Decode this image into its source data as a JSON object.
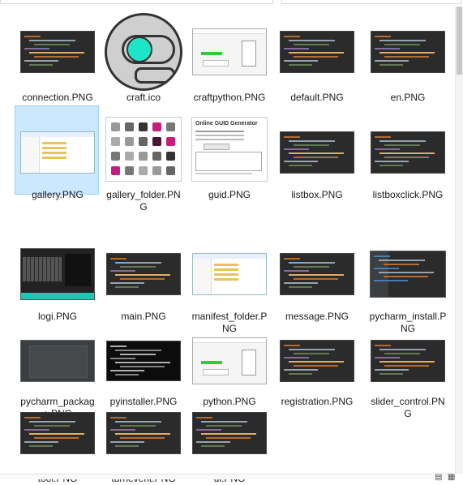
{
  "window": {
    "accent": "#0078d7",
    "selected_bg": "#cce8ff"
  },
  "files": [
    {
      "name": "connection.PNG",
      "thumb": "dark-code"
    },
    {
      "name": "craft.ico",
      "thumb": "craft-icon"
    },
    {
      "name": "craftpython.PNG",
      "thumb": "light-window"
    },
    {
      "name": "default.PNG",
      "thumb": "dark-code"
    },
    {
      "name": "en.PNG",
      "thumb": "dark-code"
    },
    {
      "name": "gallery.PNG",
      "thumb": "explorer",
      "selected": true
    },
    {
      "name": "gallery_folder.PNG",
      "thumb": "icon-grid"
    },
    {
      "name": "guid.PNG",
      "thumb": "guid-page"
    },
    {
      "name": "listbox.PNG",
      "thumb": "dark-code"
    },
    {
      "name": "listboxclick.PNG",
      "thumb": "dark-code"
    },
    {
      "name": "logi.PNG",
      "thumb": "keyboard"
    },
    {
      "name": "main.PNG",
      "thumb": "dark-code"
    },
    {
      "name": "manifest_folder.PNG",
      "thumb": "explorer"
    },
    {
      "name": "message.PNG",
      "thumb": "dark-code"
    },
    {
      "name": "pycharm_install.PNG",
      "thumb": "ide"
    },
    {
      "name": "pycharm_package.PNG",
      "thumb": "ide-dialog"
    },
    {
      "name": "pyinstaller.PNG",
      "thumb": "terminal"
    },
    {
      "name": "python.PNG",
      "thumb": "light-window"
    },
    {
      "name": "registration.PNG",
      "thumb": "dark-code"
    },
    {
      "name": "slider_control.PNG",
      "thumb": "dark-code"
    },
    {
      "name": "tool.PNG",
      "thumb": "dark-code"
    },
    {
      "name": "turnevent.PNG",
      "thumb": "dark-code"
    },
    {
      "name": "ui.PNG",
      "thumb": "dark-code"
    }
  ],
  "guid_page": {
    "title": "Online GUID Generator"
  }
}
